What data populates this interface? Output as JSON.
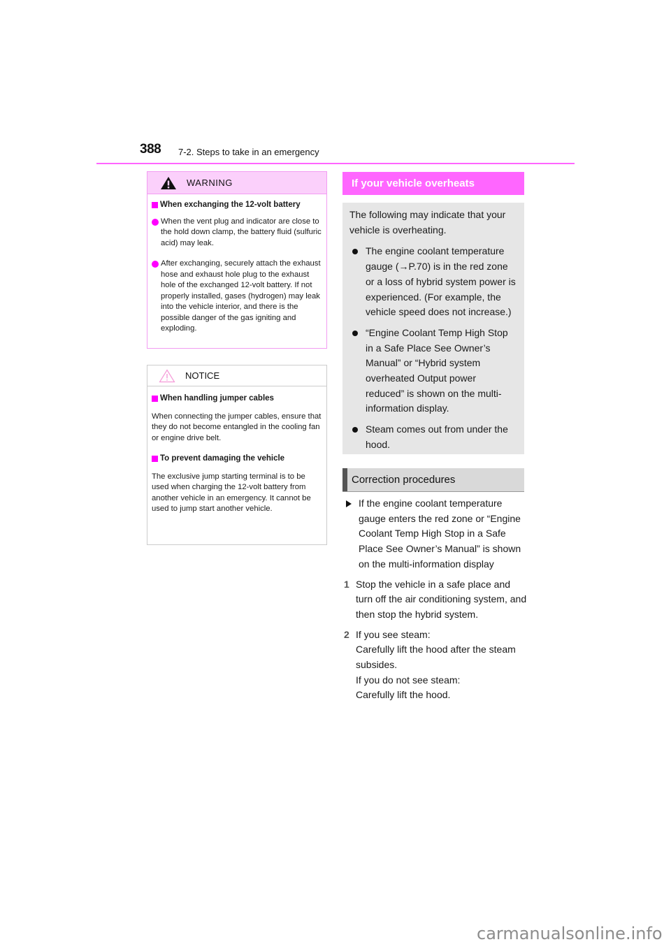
{
  "header": {
    "page_number": "388",
    "section": "7-2. Steps to take in an emergency"
  },
  "warning": {
    "label": "WARNING",
    "icon": "warning-triangle-icon",
    "subheading": "When exchanging the 12-volt battery",
    "bullets": [
      "When the vent plug and indicator are close to the hold down clamp, the battery fluid (sulfuric acid) may leak.",
      "After exchanging, securely attach the exhaust hose and exhaust hole plug to the exhaust hole of the exchanged 12-volt battery. If not properly installed, gases (hydrogen) may leak into the vehicle interior, and there is the possible danger of the gas igniting and exploding."
    ]
  },
  "notice": {
    "label": "NOTICE",
    "icon": "caution-triangle-outline-icon",
    "sections": [
      {
        "subheading": "When handling jumper cables",
        "text": "When connecting the jumper cables, ensure that they do not become entangled in the cooling fan or engine drive belt."
      },
      {
        "subheading": "To prevent damaging the vehicle",
        "text": "The exclusive jump starting terminal is to be used when charging the 12-volt battery from another vehicle in an emergency. It cannot be used to jump start another vehicle."
      }
    ]
  },
  "overheat": {
    "title": "If your vehicle overheats",
    "intro": "The following may indicate that your vehicle is overheating.",
    "indicators": [
      "The engine coolant temperature gauge (→P.70) is in the red zone or a loss of hybrid system power is experienced. (For example, the vehicle speed does not increase.)",
      "“Engine Coolant Temp High Stop in a Safe Place See Owner’s Manual” or “Hybrid system overheated Output power reduced” is shown on the multi-information display.",
      "Steam comes out from under the hood."
    ]
  },
  "correction": {
    "title": "Correction procedures",
    "condition": "If the engine coolant temperature gauge enters the red zone or “Engine Coolant Temp High Stop in a Safe Place See Owner’s Manual” is shown on the multi-information display",
    "steps": [
      {
        "num": "1",
        "lines": [
          "Stop the vehicle in a safe place and turn off the air conditioning system, and then stop the hybrid system."
        ]
      },
      {
        "num": "2",
        "lines": [
          "If you see steam:",
          "Carefully lift the hood after the steam subsides.",
          "If you do not see steam:",
          "Carefully lift the hood."
        ]
      }
    ]
  },
  "colors": {
    "accent": "#ff66ff",
    "warning_header_bg": "#fbd0fb",
    "indicator_bg": "#e6e6e6",
    "correction_header_bg": "#d9d9d9"
  },
  "watermark": "carmanualsonline.info"
}
